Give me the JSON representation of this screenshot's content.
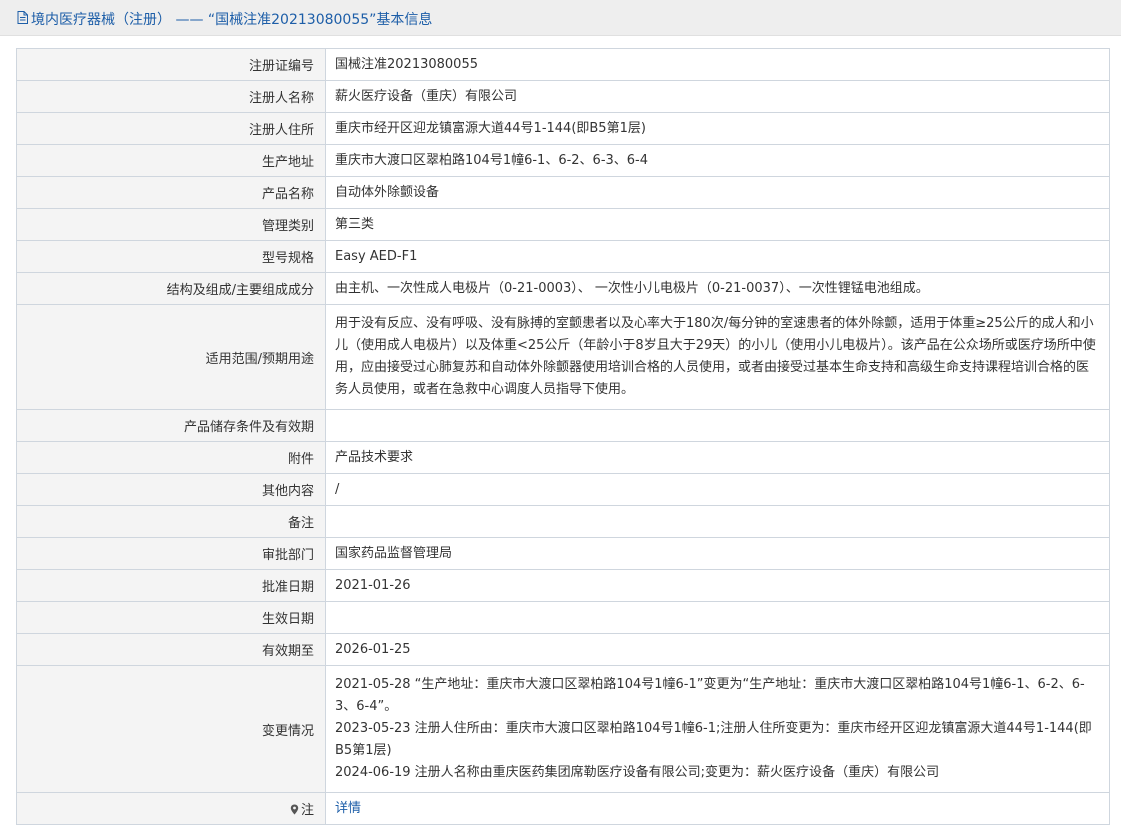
{
  "header": {
    "title": "境内医疗器械（注册） —— “国械注准20213080055”基本信息",
    "icon": "document-icon"
  },
  "rows": [
    {
      "label": "注册证编号",
      "value": "国械注准20213080055"
    },
    {
      "label": "注册人名称",
      "value": "薪火医疗设备（重庆）有限公司"
    },
    {
      "label": "注册人住所",
      "value": "重庆市经开区迎龙镇富源大道44号1-144(即B5第1层)"
    },
    {
      "label": "生产地址",
      "value": "重庆市大渡口区翠柏路104号1幢6-1、6-2、6-3、6-4"
    },
    {
      "label": "产品名称",
      "value": "自动体外除颤设备"
    },
    {
      "label": "管理类别",
      "value": "第三类"
    },
    {
      "label": "型号规格",
      "value": "Easy AED-F1"
    },
    {
      "label": "结构及组成/主要组成成分",
      "value": "由主机、一次性成人电极片（0-21-0003）、 一次性小儿电极片（0-21-0037）、一次性锂锰电池组成。"
    },
    {
      "label": "适用范围/预期用途",
      "value": "用于没有反应、没有呼吸、没有脉搏的室颤患者以及心率大于180次/每分钟的室速患者的体外除颤，适用于体重≥25公斤的成人和小儿（使用成人电极片）以及体重<25公斤（年龄小于8岁且大于29天）的小儿（使用小儿电极片）。该产品在公众场所或医疗场所中使用，应由接受过心肺复苏和自动体外除颤器使用培训合格的人员使用，或者由接受过基本生命支持和高级生命支持课程培训合格的医务人员使用，或者在急救中心调度人员指导下使用。"
    },
    {
      "label": "产品储存条件及有效期",
      "value": ""
    },
    {
      "label": "附件",
      "value": "产品技术要求"
    },
    {
      "label": "其他内容",
      "value": "/"
    },
    {
      "label": "备注",
      "value": ""
    },
    {
      "label": "审批部门",
      "value": "国家药品监督管理局"
    },
    {
      "label": "批准日期",
      "value": "2021-01-26"
    },
    {
      "label": "生效日期",
      "value": ""
    },
    {
      "label": "有效期至",
      "value": "2026-01-25"
    }
  ],
  "changes": {
    "label": "变更情况",
    "entries": [
      "2021-05-28 “生产地址：重庆市大渡口区翠柏路104号1幢6-1”变更为“生产地址：重庆市大渡口区翠柏路104号1幢6-1、6-2、6-3、6-4”。",
      "2023-05-23 注册人住所由：重庆市大渡口区翠柏路104号1幢6-1;注册人住所变更为：重庆市经开区迎龙镇富源大道44号1-144(即B5第1层)",
      "2024-06-19 注册人名称由重庆医药集团席勒医疗设备有限公司;变更为：薪火医疗设备（重庆）有限公司"
    ]
  },
  "note": {
    "label": "注",
    "icon": "map-pin-icon",
    "link_text": "详情"
  },
  "colors": {
    "title": "#1d5ea8",
    "label_bg": "#f4f4f4",
    "border": "#cfd6de",
    "header_bg": "#eeeeee"
  }
}
